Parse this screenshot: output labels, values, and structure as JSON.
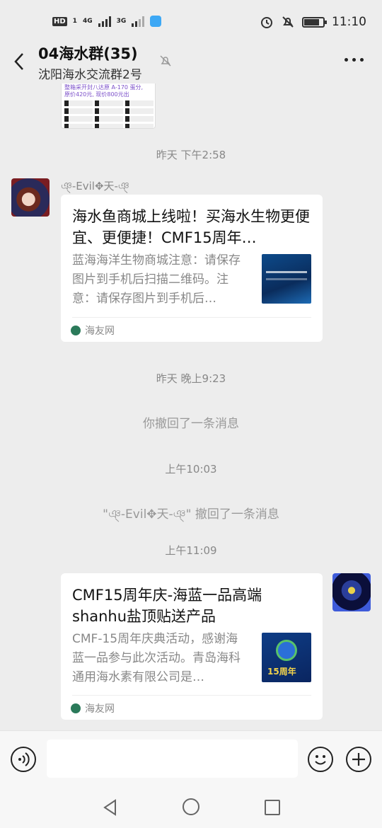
{
  "status_bar": {
    "hd": "HD",
    "sim1": "1",
    "net1": "4G",
    "net2": "3G",
    "time": "11:10",
    "battery_level": 0.8
  },
  "header": {
    "title": "04海水群(35)",
    "subtitle": "沈阳海水交流群2号"
  },
  "partial_image": {
    "line1": "整箱采开封八达原 A-170 蛋分,",
    "line2": "原价420元, 现价800元出"
  },
  "messages": {
    "time1": "昨天 下午2:58",
    "sender1": "ঞ্-Evil✥天-ঞ্",
    "card1": {
      "title": "海水鱼商城上线啦！买海水生物更便宜、更便捷！CMF15周年…",
      "desc": "蓝海海洋生物商城注意：请保存图片到手机后扫描二维码。注意：请保存图片到手机后…",
      "source": "海友网"
    },
    "time2": "昨天 晚上9:23",
    "recall1": "你撤回了一条消息",
    "time3": "上午10:03",
    "recall2": "\"ঞ্-Evil✥天-ঞ্\" 撤回了一条消息",
    "time4": "上午11:09",
    "card2": {
      "title": "CMF15周年庆-海蓝一品高端shanhu盐顶贴送产品",
      "desc": "CMF-15周年庆典活动，感谢海蓝一品参与此次活动。青岛海科通用海水素有限公司是…",
      "source": "海友网",
      "thumb_text": "15周年"
    }
  },
  "input": {
    "placeholder": ""
  }
}
